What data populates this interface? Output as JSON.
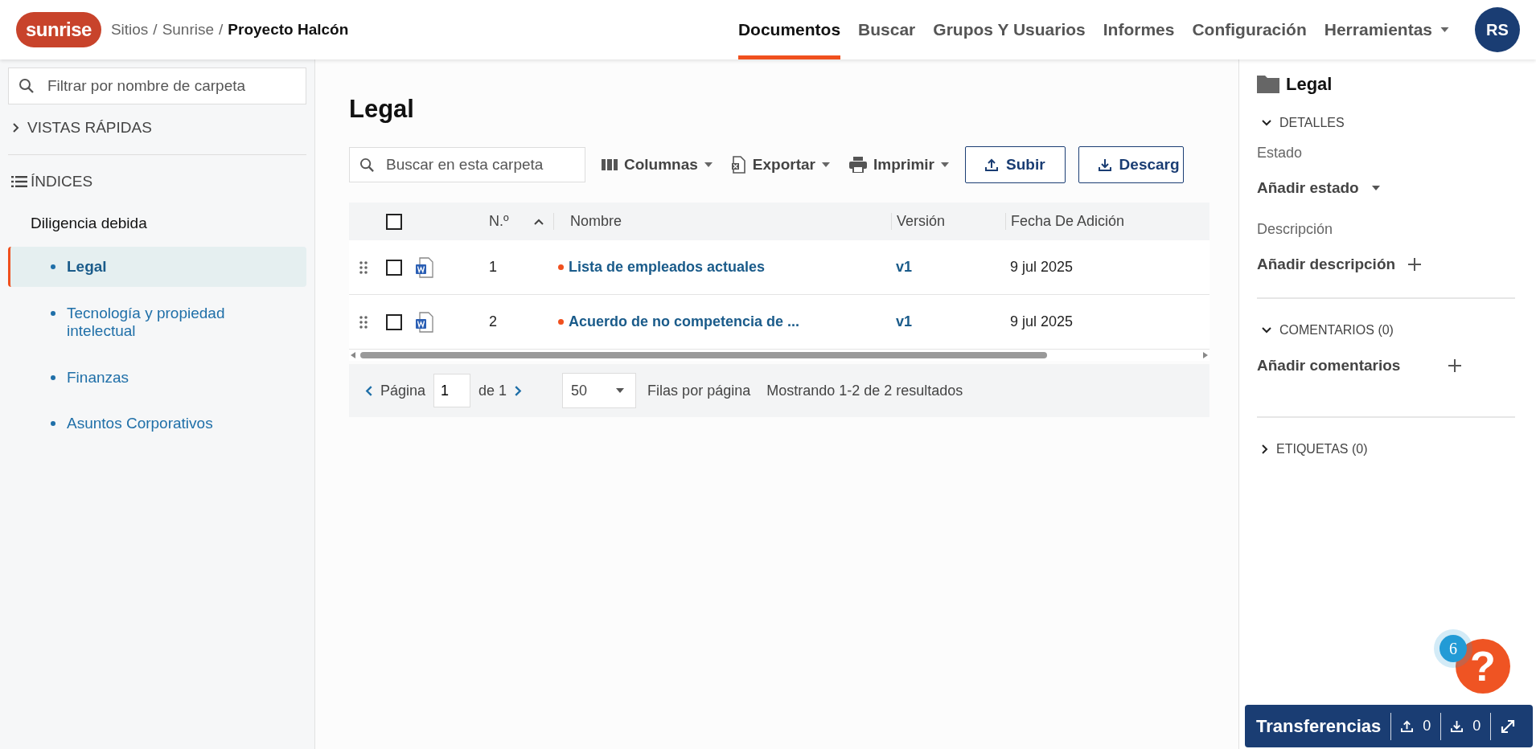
{
  "header": {
    "logo": "sunrise",
    "breadcrumb": [
      "Sitios",
      "Sunrise",
      "Proyecto Halcón"
    ],
    "separator": "/",
    "nav": [
      {
        "label": "Documentos",
        "selected": true
      },
      {
        "label": "Buscar",
        "selected": false
      },
      {
        "label": "Grupos Y Usuarios",
        "selected": false
      },
      {
        "label": "Informes",
        "selected": false
      },
      {
        "label": "Configuración",
        "selected": false
      },
      {
        "label": "Herramientas",
        "selected": false
      }
    ],
    "avatar": "RS"
  },
  "sidebar": {
    "filter": {
      "placeholder": "Filtrar por nombre de carpeta"
    },
    "quick_views": {
      "label": "VISTAS RÁPIDAS",
      "expanded": false
    },
    "indices": {
      "label": "ÍNDICES",
      "items": [
        {
          "label": "Diligencia debida",
          "selected": false,
          "children": [
            {
              "label": "Legal",
              "selected": true
            },
            {
              "label": "Tecnología y propiedad intelectual",
              "selected": false
            },
            {
              "label": "Finanzas",
              "selected": false
            },
            {
              "label": "Asuntos Corporativos",
              "selected": false
            }
          ]
        }
      ]
    }
  },
  "main": {
    "title": "Legal",
    "search": {
      "placeholder": "Buscar en esta carpeta"
    },
    "toolbar": [
      {
        "kind": "menu",
        "label": "Columnas"
      },
      {
        "kind": "menu",
        "label": "Exportar"
      },
      {
        "kind": "menu",
        "label": "Imprimir"
      },
      {
        "kind": "button",
        "label": "Subir"
      },
      {
        "kind": "button",
        "label": "Descarg"
      }
    ],
    "table": {
      "select_all": {
        "checked": false
      },
      "columns": [
        "N.º",
        "Nombre",
        "Versión",
        "Fecha De Adición"
      ],
      "rows": [
        {
          "checked": false,
          "number": "1",
          "name": "Lista de empleados actuales",
          "version": "v1",
          "date": "9 jul 2025"
        },
        {
          "checked": false,
          "number": "2",
          "name": "Acuerdo de no competencia de ...",
          "version": "v1",
          "date": "9 jul 2025"
        }
      ]
    },
    "pagination": {
      "page_label": "Página",
      "page": "1",
      "of": "de 1",
      "per_page": "50",
      "per_page_label": "Filas por página",
      "summary": "Mostrando 1-2 de 2 resultados"
    }
  },
  "details": {
    "title": "Legal",
    "sections": [
      {
        "label": "DETALLES",
        "expanded": true,
        "fields": [
          {
            "label": "Estado",
            "action": "Añadir estado",
            "kind": "dropdown"
          },
          {
            "label": "Descripción",
            "action": "Añadir descripción",
            "kind": "add"
          }
        ]
      },
      {
        "label": "COMENTARIOS (0)",
        "expanded": true,
        "fields": [
          {
            "action": "Añadir comentarios",
            "kind": "add-wide"
          }
        ]
      },
      {
        "label": "ETIQUETAS (0)",
        "expanded": false
      }
    ]
  },
  "help": {
    "badge": "6",
    "label": "?"
  },
  "transfers": {
    "label": "Transferencias",
    "uploads": "0",
    "downloads": "0"
  }
}
